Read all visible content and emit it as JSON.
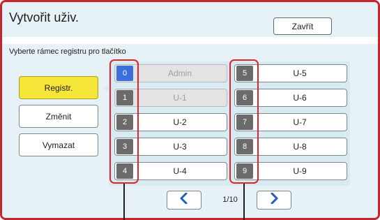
{
  "header": {
    "title": "Vytvořit uživ.",
    "close_label": "Zavřít"
  },
  "instruction": "Vyberte rámec registru pro tlačítko",
  "actions": {
    "register": "Registr.",
    "change": "Změnit",
    "delete": "Vymazat"
  },
  "slots": [
    {
      "num": "0",
      "label": "Admin"
    },
    {
      "num": "1",
      "label": "U-1"
    },
    {
      "num": "2",
      "label": "U-2"
    },
    {
      "num": "3",
      "label": "U-3"
    },
    {
      "num": "4",
      "label": "U-4"
    },
    {
      "num": "5",
      "label": "U-5"
    },
    {
      "num": "6",
      "label": "U-6"
    },
    {
      "num": "7",
      "label": "U-7"
    },
    {
      "num": "8",
      "label": "U-8"
    },
    {
      "num": "9",
      "label": "U-9"
    }
  ],
  "pagination": {
    "indicator": "1/10",
    "prev_icon": "chevron-left-icon",
    "next_icon": "chevron-right-icon"
  },
  "colors": {
    "accent_blue": "#3b6fd9",
    "selected_yellow": "#f6e63a",
    "highlight_red": "#e0242d"
  }
}
